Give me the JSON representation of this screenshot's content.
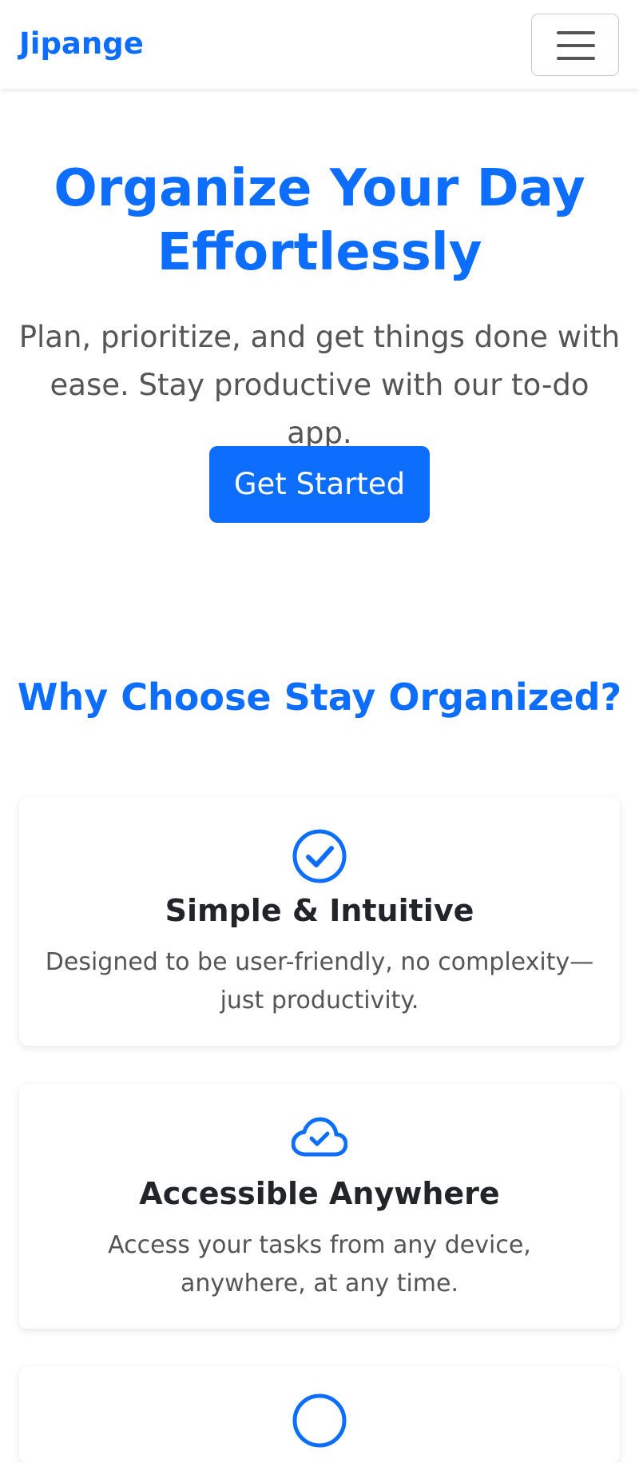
{
  "navbar": {
    "brand": "Jipange",
    "toggler_icon": "hamburger-menu-icon"
  },
  "hero": {
    "title": "Organize Your Day Effortlessly",
    "subtitle": "Plan, prioritize, and get things done with ease. Stay productive with our to-do app.",
    "cta_label": "Get Started"
  },
  "features": {
    "heading": "Why Choose Stay Organized?",
    "items": [
      {
        "icon": "check-circle-icon",
        "title": "Simple & Intuitive",
        "text": "Designed to be user-friendly, no complexity—just productivity."
      },
      {
        "icon": "cloud-check-icon",
        "title": "Accessible Anywhere",
        "text": "Access your tasks from any device, anywhere, at any time."
      }
    ]
  },
  "colors": {
    "primary": "#0d6efd",
    "muted_text": "#555555",
    "body_text": "#212529",
    "background": "#ffffff"
  }
}
